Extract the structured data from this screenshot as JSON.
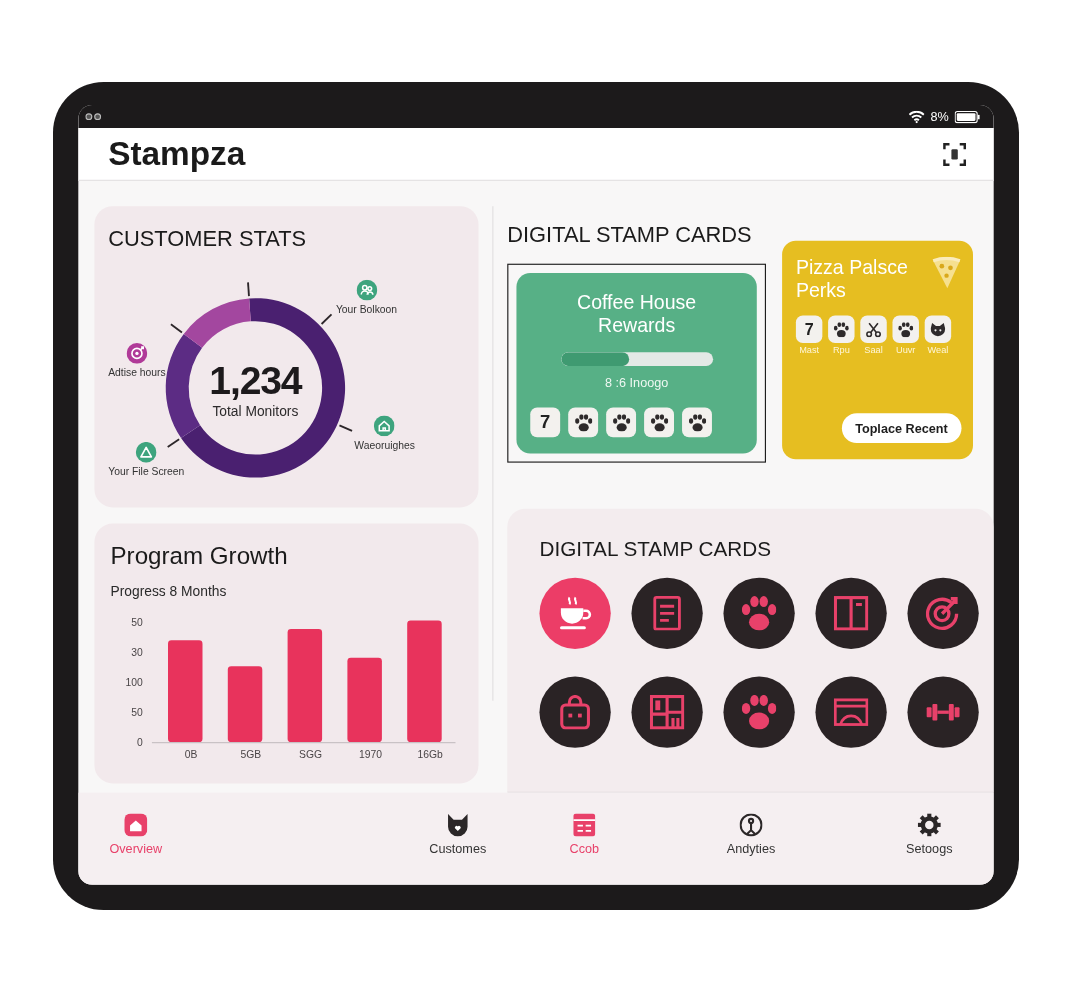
{
  "status_bar": {
    "battery": "8%"
  },
  "header": {
    "title": "Stampza"
  },
  "customer_stats": {
    "title": "CUSTOMER STATS",
    "total": "1,234",
    "total_label": "Total Monitors",
    "legend": [
      {
        "label": "Your Bolkoon",
        "kind": "group",
        "color": "#3ea47e"
      },
      {
        "label": "Adtise hours",
        "kind": "target",
        "color": "#b03a98"
      },
      {
        "label": "Waeoruighes",
        "kind": "house",
        "color": "#3ea47e"
      },
      {
        "label": "Your File Screen",
        "kind": "triangle",
        "color": "#3ea47e"
      }
    ]
  },
  "program_growth": {
    "title": "Program Growth",
    "subtitle": "Progress 8 Months",
    "y_labels": [
      "50",
      "30",
      "100",
      "50",
      "0"
    ],
    "x_labels": [
      "0B",
      "5GB",
      "SGG",
      "1970",
      "16Gb"
    ]
  },
  "stamp_cards": {
    "title": "DIGITAL STAMP CARDS",
    "cards": [
      {
        "kind": "progress",
        "title": "Coffee House Rewards",
        "color": "#57b086",
        "selected": true,
        "level": 0.45,
        "caption": "8 :6 Inoogo",
        "stamps": [
          {
            "kind": "number",
            "label": "7"
          },
          {
            "kind": "paw"
          },
          {
            "kind": "paw"
          },
          {
            "kind": "paw"
          },
          {
            "kind": "paw"
          }
        ]
      },
      {
        "kind": "reward",
        "title": "Pizza Palsce Perks",
        "color": "#e6be21",
        "selected": false,
        "stamps": [
          {
            "kind": "number",
            "label": "7",
            "caption": "Mast"
          },
          {
            "kind": "paw",
            "caption": "Rpu"
          },
          {
            "kind": "scissors",
            "caption": "Saal"
          },
          {
            "kind": "paw",
            "caption": "Uuvr"
          },
          {
            "kind": "face",
            "caption": "Weal"
          }
        ],
        "button": "Toplace Recent"
      }
    ]
  },
  "stamp_designs": {
    "title": "DIGITAL STAMP CARDS",
    "icons": [
      {
        "kind": "coffee",
        "selected": true
      },
      {
        "kind": "document",
        "selected": false
      },
      {
        "kind": "paw",
        "selected": false
      },
      {
        "kind": "book",
        "selected": false
      },
      {
        "kind": "target",
        "selected": false
      },
      {
        "kind": "bag",
        "selected": false
      },
      {
        "kind": "shelf",
        "selected": false
      },
      {
        "kind": "paw",
        "selected": false
      },
      {
        "kind": "picture",
        "selected": false
      },
      {
        "kind": "dumbbell",
        "selected": false
      }
    ]
  },
  "bottom_nav": [
    {
      "label": "Overview",
      "kind": "home",
      "selected": true
    },
    {
      "label": "Customes",
      "kind": "customers",
      "selected": false
    },
    {
      "label": "Ccob",
      "kind": "cards",
      "selected": true
    },
    {
      "label": "Andyties",
      "kind": "analytics",
      "selected": false
    },
    {
      "label": "Setoogs",
      "kind": "settings",
      "selected": false
    }
  ]
}
